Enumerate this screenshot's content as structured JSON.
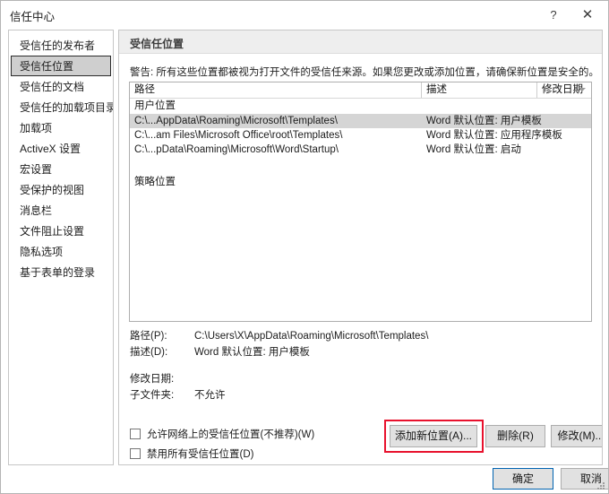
{
  "window": {
    "title": "信任中心",
    "help_label": "?",
    "close_label": "✕"
  },
  "sidebar": {
    "items": [
      {
        "label": "受信任的发布者",
        "selected": false
      },
      {
        "label": "受信任位置",
        "selected": true
      },
      {
        "label": "受信任的文档",
        "selected": false
      },
      {
        "label": "受信任的加载项目录",
        "selected": false
      },
      {
        "label": "加载项",
        "selected": false
      },
      {
        "label": "ActiveX 设置",
        "selected": false
      },
      {
        "label": "宏设置",
        "selected": false
      },
      {
        "label": "受保护的视图",
        "selected": false
      },
      {
        "label": "消息栏",
        "selected": false
      },
      {
        "label": "文件阻止设置",
        "selected": false
      },
      {
        "label": "隐私选项",
        "selected": false
      },
      {
        "label": "基于表单的登录",
        "selected": false
      }
    ]
  },
  "main": {
    "panel_title": "受信任位置",
    "warning": "警告: 所有这些位置都被视为打开文件的受信任来源。如果您更改或添加位置，请确保新位置是安全的。",
    "columns": {
      "path": "路径",
      "description": "描述",
      "modified": "修改日期"
    },
    "groups": [
      {
        "label": "用户位置",
        "rows": [
          {
            "path": "C:\\...AppData\\Roaming\\Microsoft\\Templates\\",
            "description": "Word 默认位置: 用户模板",
            "selected": true
          },
          {
            "path": "C:\\...am Files\\Microsoft Office\\root\\Templates\\",
            "description": "Word 默认位置: 应用程序模板",
            "selected": false
          },
          {
            "path": "C:\\...pData\\Roaming\\Microsoft\\Word\\Startup\\",
            "description": "Word 默认位置: 启动",
            "selected": false
          }
        ]
      },
      {
        "label": "策略位置",
        "rows": []
      }
    ],
    "detail": {
      "path_label": "路径(P):",
      "path_value": "C:\\Users\\X\\AppData\\Roaming\\Microsoft\\Templates\\",
      "desc_label": "描述(D):",
      "desc_value": "Word 默认位置: 用户模板",
      "modified_label": "修改日期:",
      "modified_value": "",
      "subfolder_label": "子文件夹:",
      "subfolder_value": "不允许"
    },
    "buttons": {
      "add_location": "添加新位置(A)...",
      "remove": "删除(R)",
      "modify": "修改(M)..."
    },
    "checkboxes": [
      {
        "label": "允许网络上的受信任位置(不推荐)(W)",
        "checked": false
      },
      {
        "label": "禁用所有受信任位置(D)",
        "checked": false
      }
    ]
  },
  "footer": {
    "ok": "确定",
    "cancel": "取消"
  },
  "colors": {
    "highlight": "#e8112d",
    "selection": "#d5d5d5",
    "header_band": "#eeeeee",
    "default_button_border": "#0063b1"
  }
}
